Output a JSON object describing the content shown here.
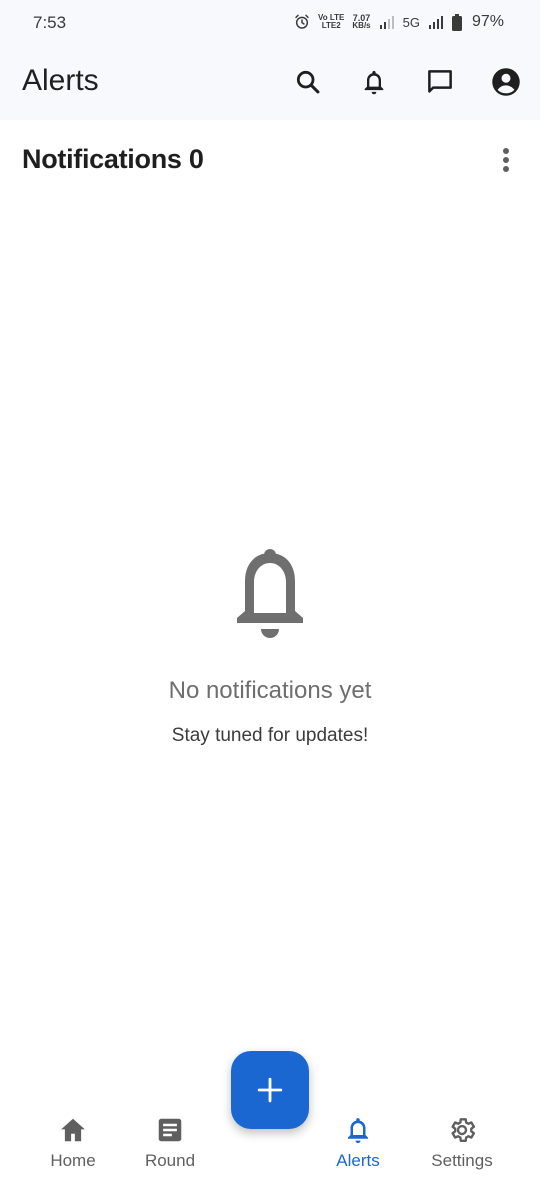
{
  "status_bar": {
    "time": "7:53",
    "volte_top": "Vo LTE",
    "lte2": "LTE2",
    "speed_value": "7.07",
    "speed_unit": "KB/s",
    "network": "5G",
    "battery": "97%",
    "icons": [
      "alarm-icon",
      "volte-icon",
      "signal-icon",
      "signal-5g-icon",
      "battery-icon"
    ]
  },
  "app_bar": {
    "title": "Alerts",
    "actions": [
      "search-icon",
      "bell-icon",
      "chat-icon",
      "account-icon"
    ]
  },
  "section": {
    "label": "Notifications",
    "count": "0"
  },
  "empty_state": {
    "icon": "bell-icon",
    "title": "No notifications yet",
    "subtitle": "Stay tuned for updates!"
  },
  "fab": {
    "icon": "plus-icon",
    "color": "#1a67d2"
  },
  "bottom_nav": {
    "items": [
      {
        "label": "Home",
        "icon": "home-icon",
        "active": false
      },
      {
        "label": "Round",
        "icon": "article-icon",
        "active": false
      },
      {
        "label": "Alerts",
        "icon": "bell-icon",
        "active": true
      },
      {
        "label": "Settings",
        "icon": "gear-icon",
        "active": false
      }
    ]
  },
  "colors": {
    "accent": "#1a67d2",
    "appbar_bg": "#f8f9fc",
    "icon_gray": "#6f6f6f",
    "text_dark": "#1f1f1f"
  }
}
